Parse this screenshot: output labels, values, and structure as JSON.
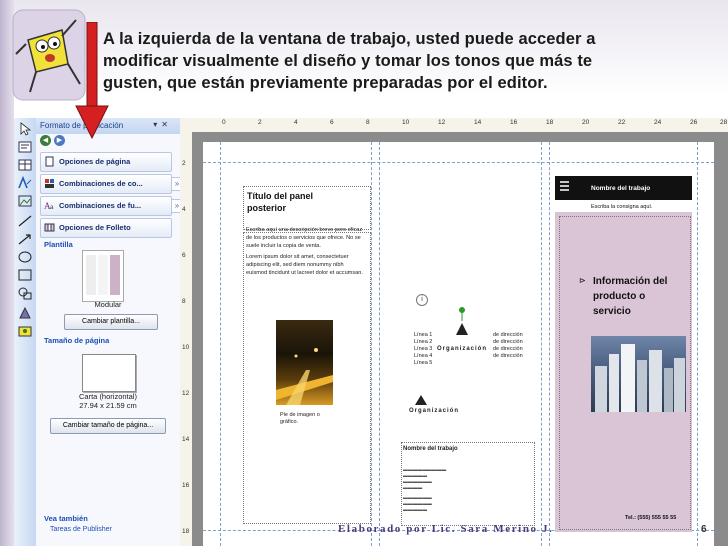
{
  "slide": {
    "header_line1": "A la izquierda de la ventana de trabajo, usted puede acceder a",
    "header_line2": "modificar visualmente el diseño y tomar los tonos que más te",
    "header_line3": "gusten, que están previamente preparadas por el editor.",
    "footer": "Elaborado por Lic. Sara Merino J.",
    "page_number": "6"
  },
  "task_pane": {
    "title": "Formato de publicación",
    "items": [
      {
        "label": "Opciones de página",
        "icon": "page-options-icon"
      },
      {
        "label": "Combinaciones de co...",
        "icon": "color-schemes-icon"
      },
      {
        "label": "Combinaciones de fu...",
        "icon": "font-schemes-icon"
      },
      {
        "label": "Opciones de Folleto",
        "icon": "brochure-options-icon"
      }
    ],
    "template_section": "Plantilla",
    "template_name": "Modular",
    "change_template_button": "Cambiar plantilla...",
    "page_size_section": "Tamaño de página",
    "page_size_name": "Carta (horizontal)",
    "page_size_dims": "27.94 x 21.59 cm",
    "change_size_button": "Cambiar tamaño de página...",
    "see_also": "Vea también",
    "tasks_link": "Tareas de Publisher"
  },
  "ruler": {
    "top": [
      "0",
      "2",
      "4",
      "6",
      "8",
      "10",
      "12",
      "14",
      "16",
      "18",
      "20",
      "22",
      "24",
      "26",
      "28"
    ],
    "left": [
      "2",
      "4",
      "6",
      "8",
      "10",
      "12",
      "14",
      "16",
      "18"
    ]
  },
  "document": {
    "panel_title_line1": "Título del panel",
    "panel_title_line2": "posterior",
    "panel_body_1": "Escriba aquí una descripción breve pero eficaz de los productos o servicios que ofrece. No se suele incluir la copia de venta.",
    "panel_body_2": "Lorem ipsum dolor sit amet, consectetuer adipiscing elit, sed diem nonummy nibh euismod tincidunt ut lacreet dolor et accumsan.",
    "photo_caption": "Pie de imagen o gráfico.",
    "org_lines": [
      "Línea 1",
      "Línea 2",
      "Línea 3",
      "Línea 4",
      "Línea 5"
    ],
    "org_right_lines": [
      "de dirección",
      "de dirección",
      "de dirección",
      "de dirección"
    ],
    "org_label_1": "Organización",
    "org_label_2": "Organización",
    "job_name": "Nombre del trabajo",
    "right_header": "Nombre del trabajo",
    "right_subheader": "Escriba la consigna aquí.",
    "info_heading_1": "Información del",
    "info_heading_2": "producto o",
    "info_heading_3": "servicio",
    "tel": "Tel.: (555) 555 55 55"
  },
  "colors": {
    "arrow": "#d42020",
    "pink_panel": "#d9c5d5",
    "pane_link": "#1b4fb5",
    "footer": "#4b3c7a"
  }
}
